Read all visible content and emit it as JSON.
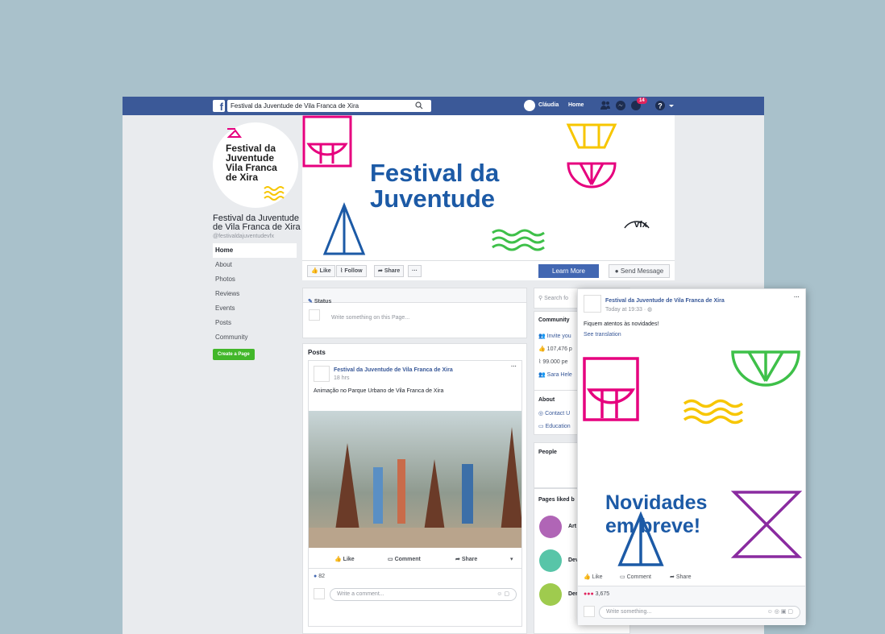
{
  "topbar": {
    "search_value": "Festival da Juventude de Vila Franca de Xira",
    "user": "Cláudia",
    "home": "Home",
    "badge": "14"
  },
  "profile": {
    "title": "Festival da Juventude Vila Franca de Xira",
    "name": "Festival da Juventude de Vila Franca de Xira",
    "handle": "@festivaldajuventudevfx"
  },
  "nav": [
    "Home",
    "About",
    "Photos",
    "Reviews",
    "Events",
    "Posts",
    "Community"
  ],
  "create_page": "Create a Page",
  "cover": {
    "title_line1": "Festival da",
    "title_line2": "Juventude",
    "brand": "vfx"
  },
  "actions": {
    "like": "Like",
    "follow": "Follow",
    "share": "Share",
    "more": "···",
    "learn_more": "Learn More",
    "send_message": "Send Message"
  },
  "status": {
    "label": "Status",
    "placeholder": "Write something on this Page..."
  },
  "posts": {
    "heading": "Posts",
    "author": "Festival da Juventude de Vila Franca de Xira",
    "time": "18 hrs",
    "text": "Animação no Parque Urbano de Vila Franca de Xira",
    "like": "Like",
    "comment": "Comment",
    "share": "Share",
    "reactions": "82",
    "comment_placeholder": "Write a comment..."
  },
  "right": {
    "search": "Search fo",
    "community": "Community",
    "invite": "Invite you",
    "likes": "107,476 p",
    "follows": "99.000 pe",
    "friend": "Sara Hele",
    "about": "About",
    "contact": "Contact U",
    "education": "Education",
    "people": "People",
    "pages_liked": "Pages liked b",
    "liked1": "Art",
    "liked2": "Dev",
    "liked3": "Der"
  },
  "popup": {
    "author": "Festival da Juventude de Vila Franca de Xira",
    "time": "Today at 19:33 ·",
    "more": "···",
    "text": "Fiquem atentos às novidades!",
    "translation": "See translation",
    "headline1": "Novidades",
    "headline2": "em breve!",
    "like": "Like",
    "comment": "Comment",
    "share": "Share",
    "reactions": "3,675",
    "placeholder": "Write something..."
  }
}
